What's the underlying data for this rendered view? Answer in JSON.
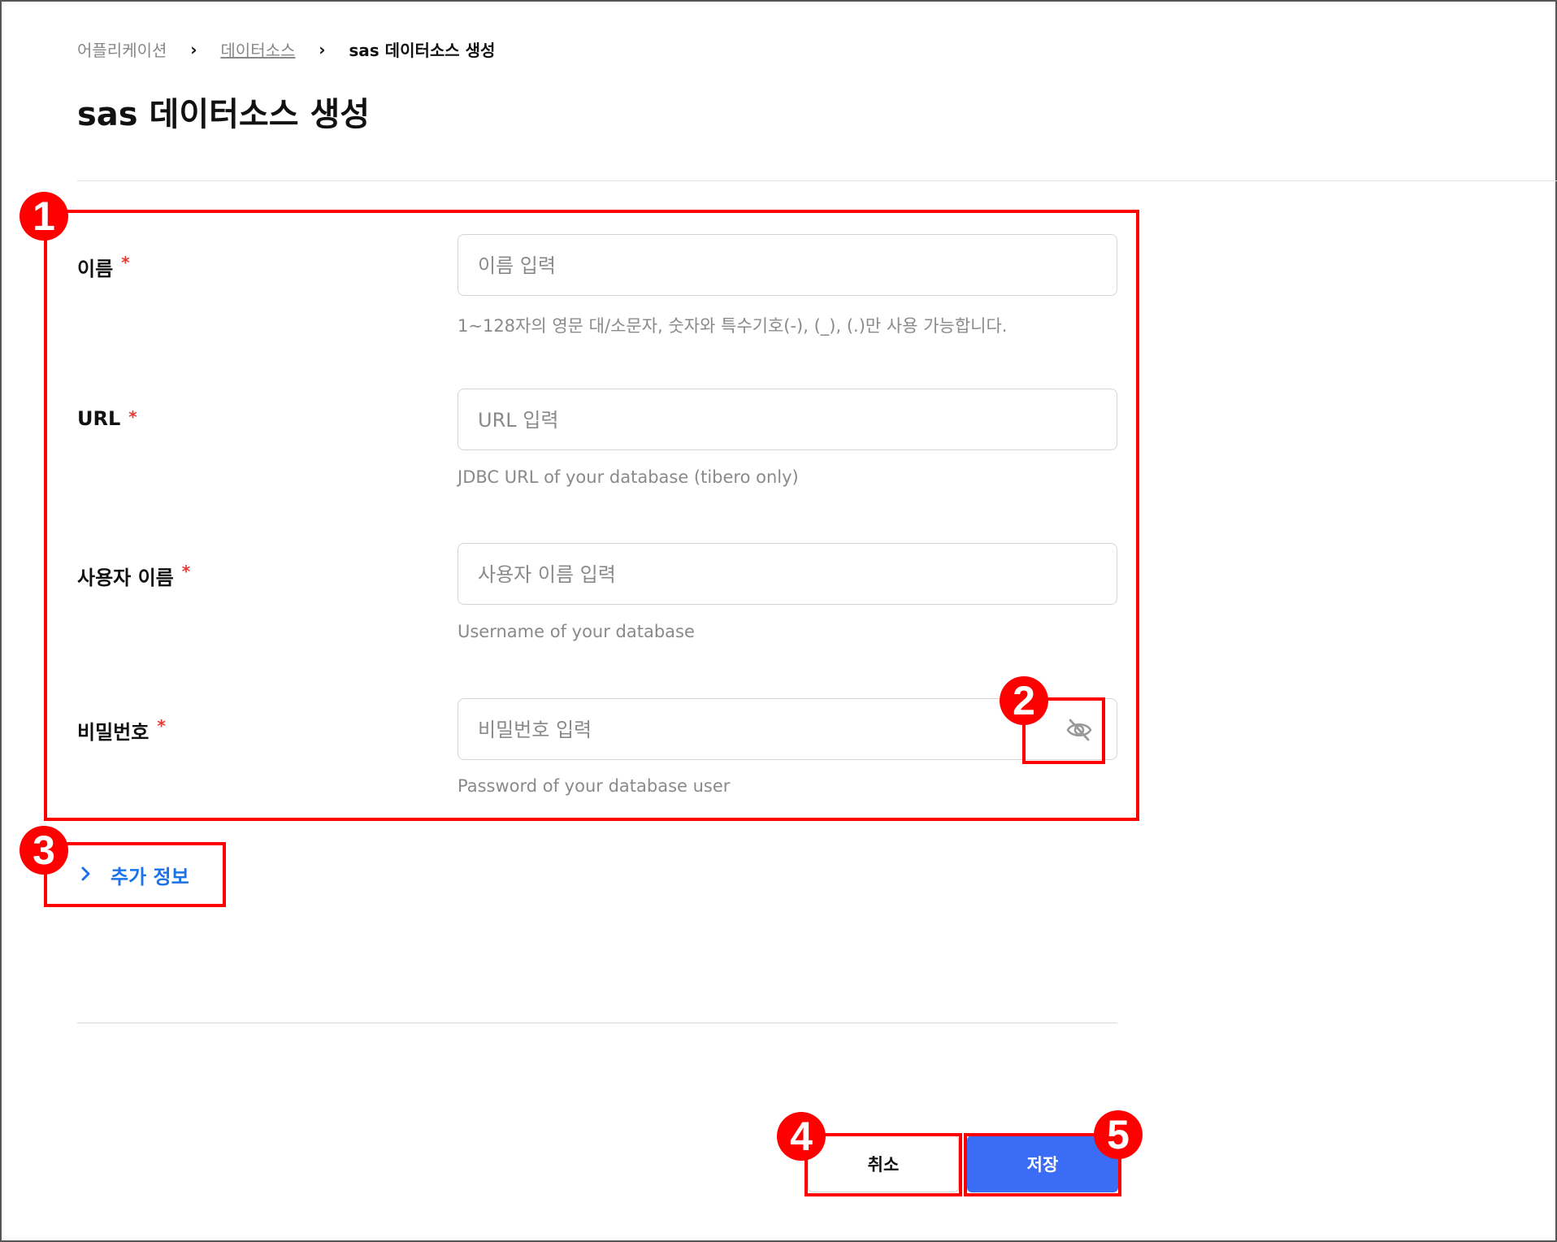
{
  "breadcrumb": {
    "items": [
      "어플리케이션",
      "데이터소스",
      "sas 데이터소스 생성"
    ],
    "separator": "›"
  },
  "page": {
    "title": "sas 데이터소스 생성"
  },
  "form": {
    "required_mark": "*",
    "fields": [
      {
        "label": "이름",
        "placeholder": "이름 입력",
        "help": "1~128자의 영문 대/소문자, 숫자와 특수기호(-), (_), (.)만 사용 가능합니다."
      },
      {
        "label": "URL",
        "placeholder": "URL 입력",
        "help": "JDBC URL of your database (tibero only)"
      },
      {
        "label": "사용자 이름",
        "placeholder": "사용자 이름 입력",
        "help": "Username of your database"
      },
      {
        "label": "비밀번호",
        "placeholder": "비밀번호 입력",
        "help": "Password of your database user",
        "icon": "eye-off-icon"
      }
    ]
  },
  "additional_info": {
    "label": "추가 정보",
    "icon": "chevron-right-icon"
  },
  "actions": {
    "cancel_label": "취소",
    "save_label": "저장"
  },
  "annotations": [
    "1",
    "2",
    "3",
    "4",
    "5"
  ],
  "colors": {
    "accent": "#3b6cf6",
    "link": "#1a73e8",
    "required": "#e53935",
    "annotation": "#ff0000"
  }
}
